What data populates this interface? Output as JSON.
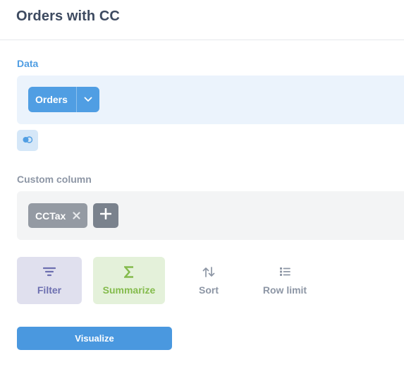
{
  "header": {
    "title": "Orders with CC"
  },
  "data_section": {
    "label": "Data",
    "source": {
      "label": "Orders",
      "chevron_icon": "chevron-down-icon"
    },
    "join_icon": "join-icon"
  },
  "custom_section": {
    "label": "Custom column",
    "columns": [
      {
        "label": "CCTax",
        "remove_icon": "close-icon"
      }
    ],
    "add_icon": "plus-icon"
  },
  "actions": [
    {
      "label": "Filter",
      "icon": "filter-icon",
      "color": "#6d6fb0"
    },
    {
      "label": "Summarize",
      "icon": "sigma-icon",
      "color": "#84bb4c"
    },
    {
      "label": "Sort",
      "icon": "sort-icon",
      "color": "#8d96a5"
    },
    {
      "label": "Row limit",
      "icon": "list-icon",
      "color": "#8d96a5"
    }
  ],
  "visualize": {
    "label": "Visualize"
  },
  "colors": {
    "brand": "#509ee3",
    "data_panel_bg": "#ebf3fc",
    "custom_panel_bg": "#f3f4f5",
    "filter_bg": "#e0e0ee",
    "summarize_bg": "#e4f1da"
  }
}
